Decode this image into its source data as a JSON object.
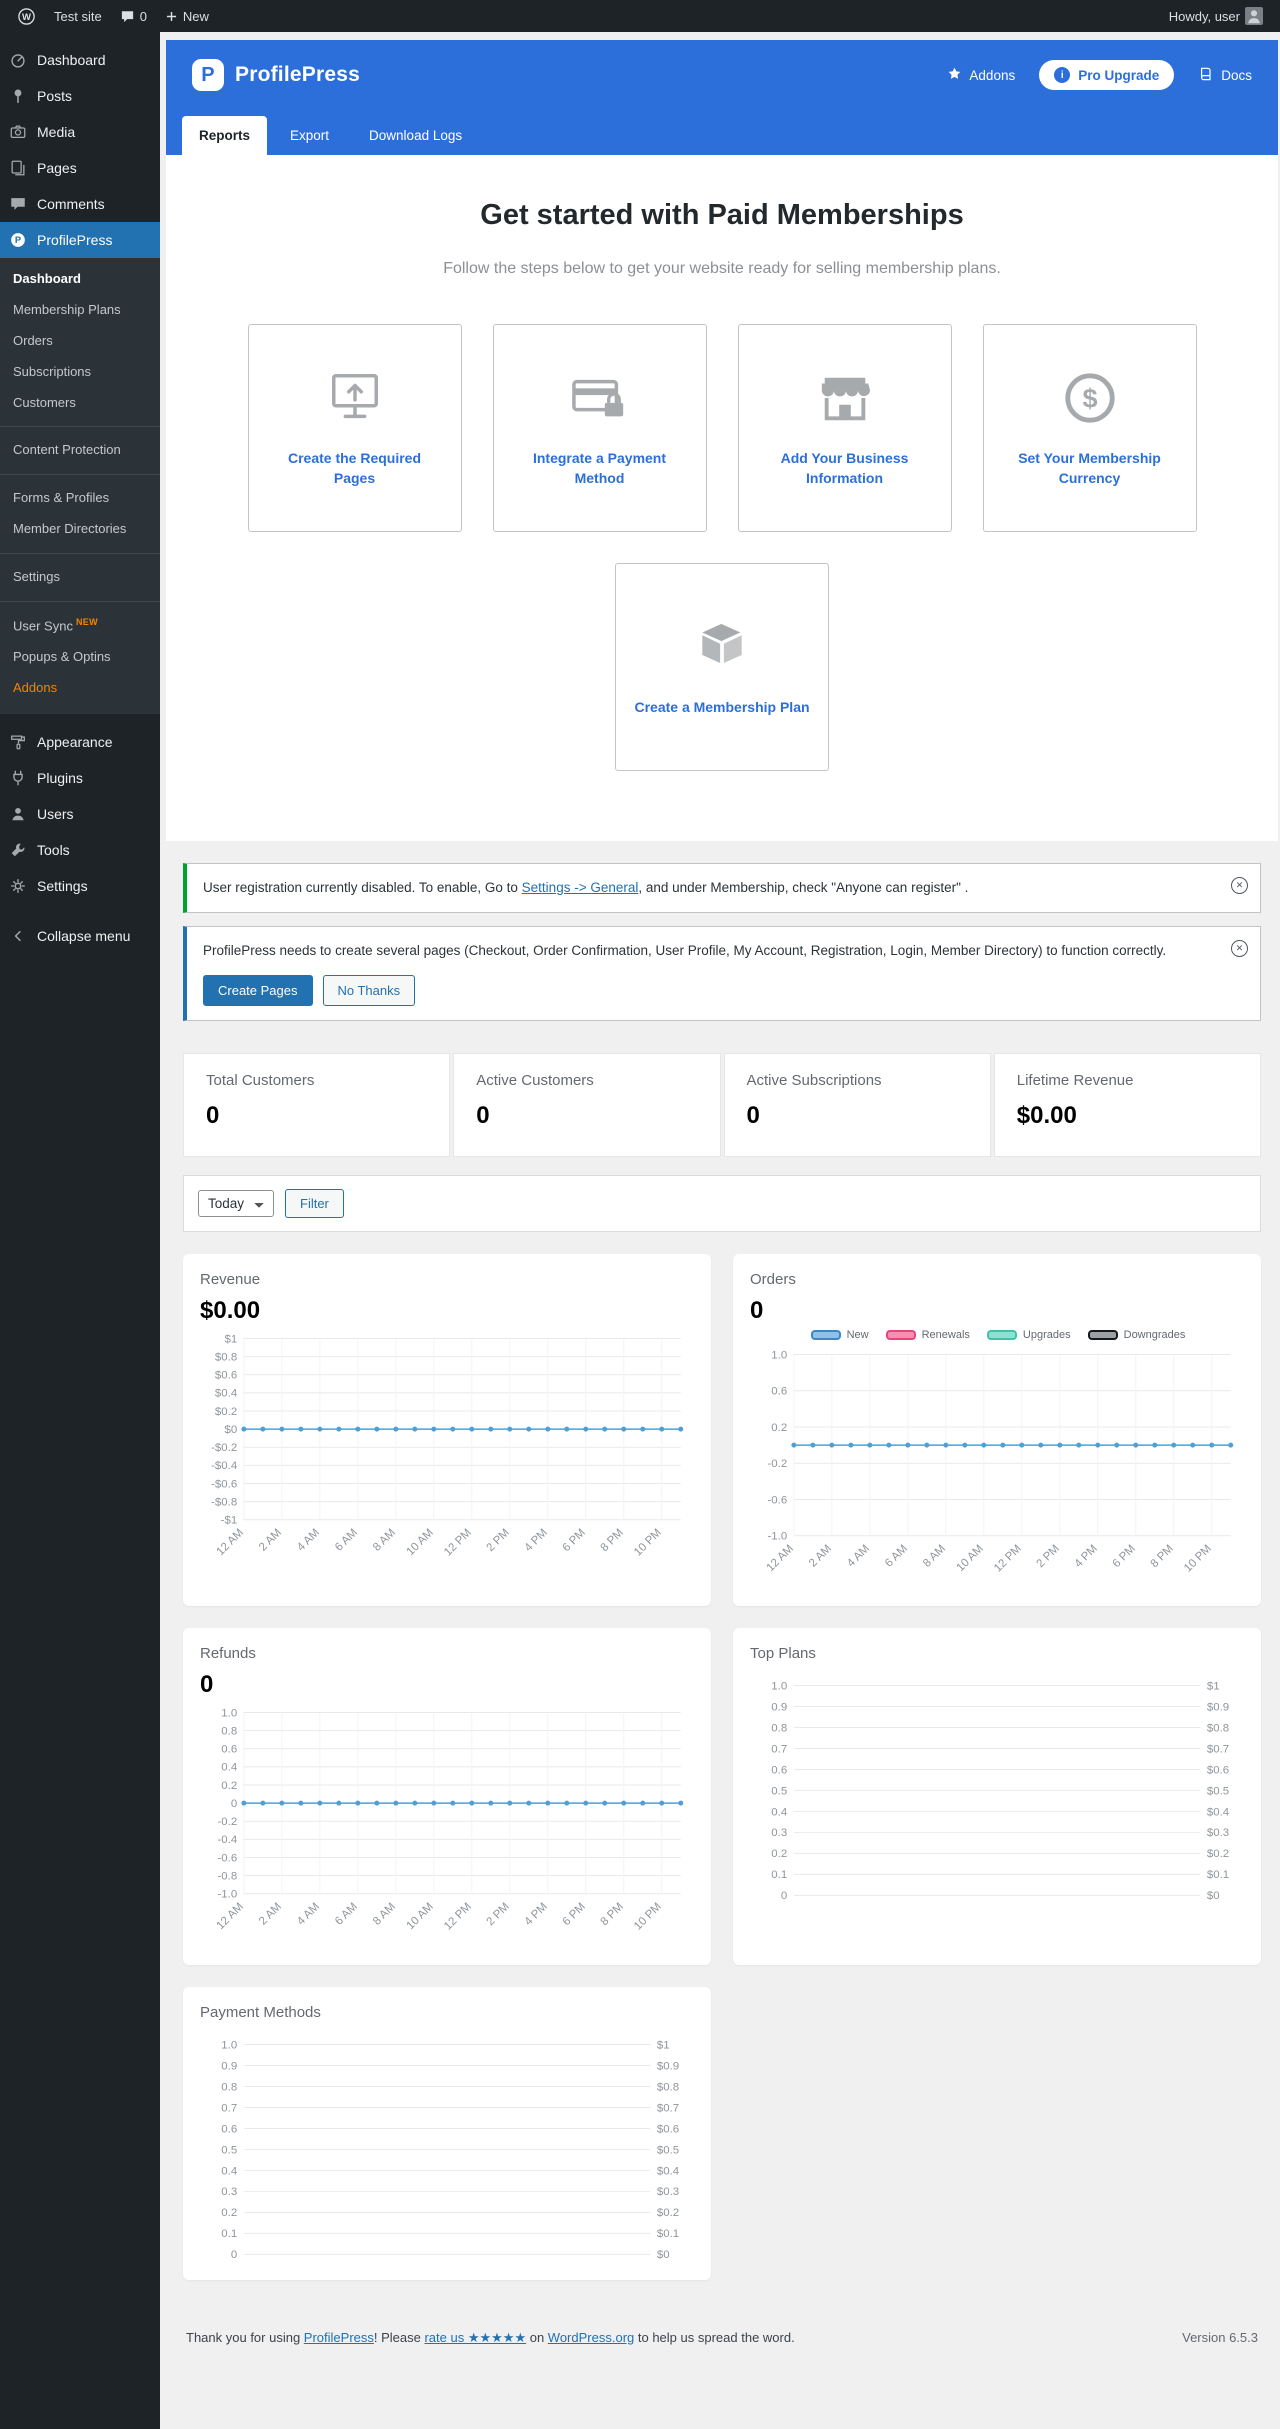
{
  "admin_bar": {
    "site_name": "Test site",
    "comments_count": "0",
    "new_label": "New",
    "howdy": "Howdy, user"
  },
  "sidebar": {
    "items": [
      {
        "label": "Dashboard"
      },
      {
        "label": "Posts"
      },
      {
        "label": "Media"
      },
      {
        "label": "Pages"
      },
      {
        "label": "Comments"
      },
      {
        "label": "ProfilePress"
      },
      {
        "label": "Appearance"
      },
      {
        "label": "Plugins"
      },
      {
        "label": "Users"
      },
      {
        "label": "Tools"
      },
      {
        "label": "Settings"
      },
      {
        "label": "Collapse menu"
      }
    ],
    "submenu": [
      {
        "label": "Dashboard"
      },
      {
        "label": "Membership Plans"
      },
      {
        "label": "Orders"
      },
      {
        "label": "Subscriptions"
      },
      {
        "label": "Customers"
      },
      {
        "label": "Content Protection"
      },
      {
        "label": "Forms & Profiles"
      },
      {
        "label": "Member Directories"
      },
      {
        "label": "Settings"
      },
      {
        "label": "User Sync",
        "badge": "NEW"
      },
      {
        "label": "Popups & Optins"
      },
      {
        "label": "Addons"
      }
    ]
  },
  "header": {
    "brand": "ProfilePress",
    "addons_label": "Addons",
    "pro_upgrade_label": "Pro Upgrade",
    "docs_label": "Docs"
  },
  "tabs": {
    "reports": "Reports",
    "export": "Export",
    "download_logs": "Download Logs"
  },
  "get_started": {
    "title": "Get started with Paid Memberships",
    "subtitle": "Follow the steps below to get your website ready for selling membership plans.",
    "cards": [
      {
        "label": "Create the Required Pages"
      },
      {
        "label": "Integrate a Payment Method"
      },
      {
        "label": "Add Your Business Information"
      },
      {
        "label": "Set Your Membership Currency"
      },
      {
        "label": "Create a Membership Plan"
      }
    ]
  },
  "notices": {
    "registration": {
      "pre": "User registration currently disabled. To enable, Go to ",
      "link": "Settings -> General",
      "post": ", and under Membership, check \"Anyone can register\" ."
    },
    "pages": {
      "text": "ProfilePress needs to create several pages (Checkout, Order Confirmation, User Profile, My Account, Registration, Login, Member Directory) to function correctly.",
      "create_button": "Create Pages",
      "dismiss_button": "No Thanks"
    }
  },
  "stats": [
    {
      "label": "Total Customers",
      "value": "0"
    },
    {
      "label": "Active Customers",
      "value": "0"
    },
    {
      "label": "Active Subscriptions",
      "value": "0"
    },
    {
      "label": "Lifetime Revenue",
      "value": "$0.00"
    }
  ],
  "filter": {
    "selected_option": "Today",
    "button_label": "Filter"
  },
  "chart_data": [
    {
      "type": "line",
      "title": "Revenue",
      "value": "$0.00",
      "ylim": [
        -1,
        1
      ],
      "y_ticks": [
        "$1",
        "$0.8",
        "$0.6",
        "$0.4",
        "$0.2",
        "$0",
        "-$0.2",
        "-$0.4",
        "-$0.6",
        "-$0.8",
        "-$1"
      ],
      "x_ticks": [
        "12 AM",
        "2 AM",
        "4 AM",
        "6 AM",
        "8 AM",
        "10 AM",
        "12 PM",
        "2 PM",
        "4 PM",
        "6 PM",
        "8 PM",
        "10 PM"
      ],
      "series": [
        {
          "name": "Revenue",
          "color": "#4e9fd8",
          "values": [
            0,
            0,
            0,
            0,
            0,
            0,
            0,
            0,
            0,
            0,
            0,
            0,
            0,
            0,
            0,
            0,
            0,
            0,
            0,
            0,
            0,
            0,
            0,
            0
          ]
        }
      ]
    },
    {
      "type": "line",
      "title": "Orders",
      "value": "0",
      "ylim": [
        -1,
        1
      ],
      "legend": [
        {
          "label": "New",
          "fill": "#8ec2ec",
          "border": "#3d87c8"
        },
        {
          "label": "Renewals",
          "fill": "#f78fb0",
          "border": "#e9447a"
        },
        {
          "label": "Upgrades",
          "fill": "#8fe0d0",
          "border": "#3ec3a6"
        },
        {
          "label": "Downgrades",
          "fill": "#9ba1a7",
          "border": "#16191c"
        }
      ],
      "y_ticks": [
        "1.0",
        "0.6",
        "0.2",
        "-0.2",
        "-0.6",
        "-1.0"
      ],
      "x_ticks": [
        "12 AM",
        "2 AM",
        "4 AM",
        "6 AM",
        "8 AM",
        "10 AM",
        "12 PM",
        "2 PM",
        "4 PM",
        "6 PM",
        "8 PM",
        "10 PM"
      ],
      "series": [
        {
          "name": "New",
          "color": "#4e9fd8",
          "values": [
            0,
            0,
            0,
            0,
            0,
            0,
            0,
            0,
            0,
            0,
            0,
            0,
            0,
            0,
            0,
            0,
            0,
            0,
            0,
            0,
            0,
            0,
            0,
            0
          ]
        }
      ]
    },
    {
      "type": "line",
      "title": "Refunds",
      "value": "0",
      "ylim": [
        -1,
        1
      ],
      "y_ticks": [
        "1.0",
        "0.8",
        "0.6",
        "0.4",
        "0.2",
        "0",
        "-0.2",
        "-0.4",
        "-0.6",
        "-0.8",
        "-1.0"
      ],
      "x_ticks": [
        "12 AM",
        "2 AM",
        "4 AM",
        "6 AM",
        "8 AM",
        "10 AM",
        "12 PM",
        "2 PM",
        "4 PM",
        "6 PM",
        "8 PM",
        "10 PM"
      ],
      "series": [
        {
          "name": "Refunds",
          "color": "#4e9fd8",
          "values": [
            0,
            0,
            0,
            0,
            0,
            0,
            0,
            0,
            0,
            0,
            0,
            0,
            0,
            0,
            0,
            0,
            0,
            0,
            0,
            0,
            0,
            0,
            0,
            0
          ]
        }
      ]
    },
    {
      "type": "line",
      "title": "Top Plans",
      "ylim": [
        0,
        1
      ],
      "y_ticks": [
        "1.0",
        "0.9",
        "0.8",
        "0.7",
        "0.6",
        "0.5",
        "0.4",
        "0.3",
        "0.2",
        "0.1",
        "0"
      ],
      "y_ticks_right": [
        "$1",
        "$0.9",
        "$0.8",
        "$0.7",
        "$0.6",
        "$0.5",
        "$0.4",
        "$0.3",
        "$0.2",
        "$0.1",
        "$0"
      ],
      "series": []
    },
    {
      "type": "line",
      "title": "Payment Methods",
      "ylim": [
        0,
        1
      ],
      "y_ticks": [
        "1.0",
        "0.9",
        "0.8",
        "0.7",
        "0.6",
        "0.5",
        "0.4",
        "0.3",
        "0.2",
        "0.1",
        "0"
      ],
      "y_ticks_right": [
        "$1",
        "$0.9",
        "$0.8",
        "$0.7",
        "$0.6",
        "$0.5",
        "$0.4",
        "$0.3",
        "$0.2",
        "$0.1",
        "$0"
      ],
      "series": []
    }
  ],
  "footer": {
    "pre": "Thank you for using ",
    "link1": "ProfilePress",
    "mid1": "! Please ",
    "link2": "rate us ★★★★★",
    "mid2": " on ",
    "link3": "WordPress.org",
    "post": " to help us spread the word.",
    "version": "Version 6.5.3"
  },
  "colors": {
    "header_blue": "#2c6fdb",
    "wp_blue": "#2271b1",
    "success_green": "#00a32a",
    "line_blue": "#4e9fd8",
    "icon_gray": "#a7aaad"
  }
}
